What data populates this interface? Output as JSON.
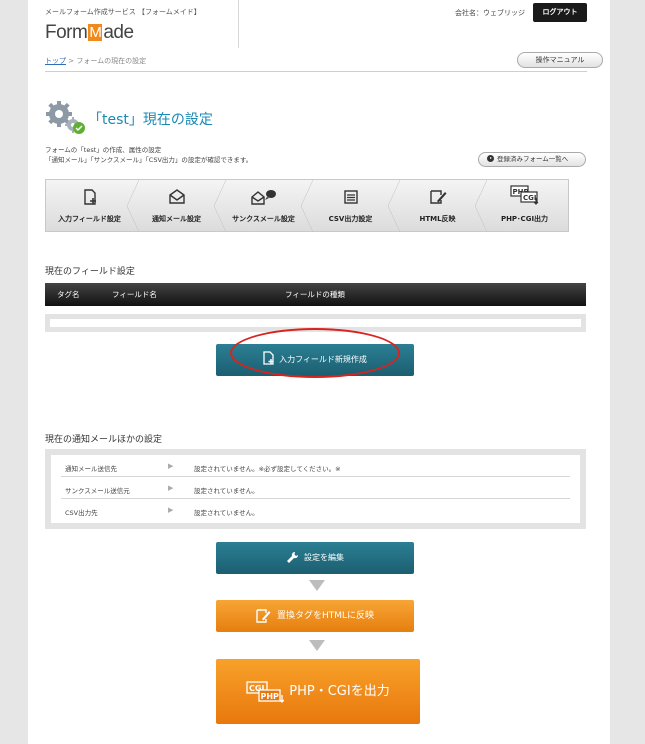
{
  "header": {
    "tagline": "メールフォーム作成サービス 【フォームメイド】",
    "logo_pre": "Form",
    "logo_m": "M",
    "logo_post": "ade",
    "company": "会社名：ウェブリッジ",
    "logout_label": "ログアウト"
  },
  "breadcrumb": {
    "top_link": "トップ",
    "separator": " > ",
    "current": "フォームの現在の設定"
  },
  "manual_button": "操作マニュアル",
  "page_title": "「test」現在の設定",
  "description": {
    "line1": "フォームの「test」の作成、属性の設定",
    "line2": "「通知メール」「サンクスメール」「CSV出力」の設定が確認できます。"
  },
  "registered_forms_button": "登録済みフォーム一覧へ",
  "steps": [
    {
      "label": "入力フィールド設定",
      "icon": "document-add-icon"
    },
    {
      "label": "通知メール設定",
      "icon": "envelope-icon"
    },
    {
      "label": "サンクスメール設定",
      "icon": "envelope-speech-icon"
    },
    {
      "label": "CSV出力設定",
      "icon": "list-icon"
    },
    {
      "label": "HTML反映",
      "icon": "edit-icon"
    },
    {
      "label": "PHP･CGI出力",
      "icon": "php-cgi-icon"
    }
  ],
  "fields_section": {
    "title": "現在のフィールド設定",
    "columns": [
      "タグ名",
      "フィールド名",
      "フィールドの種類"
    ],
    "new_field_button": "入力フィールド新規作成"
  },
  "notify_section": {
    "title": "現在の通知メールほかの設定",
    "rows": [
      {
        "label": "通知メール送信先",
        "arrow": "▶",
        "value": "設定されていません。※必ず設定してください。※"
      },
      {
        "label": "サンクスメール送信元",
        "arrow": "▶",
        "value": "設定されていません。"
      },
      {
        "label": "CSV出力先",
        "arrow": "▶",
        "value": "設定されていません。"
      }
    ]
  },
  "edit_button": "設定を編集",
  "reflect_button": "置換タグをHTMLに反映",
  "output_button": "PHP・CGIを出力",
  "colors": {
    "teal_button": "#1b5f70",
    "orange_button": "#e67f0f",
    "title_blue": "#1a8ab5",
    "highlight_red": "#d9231f"
  }
}
